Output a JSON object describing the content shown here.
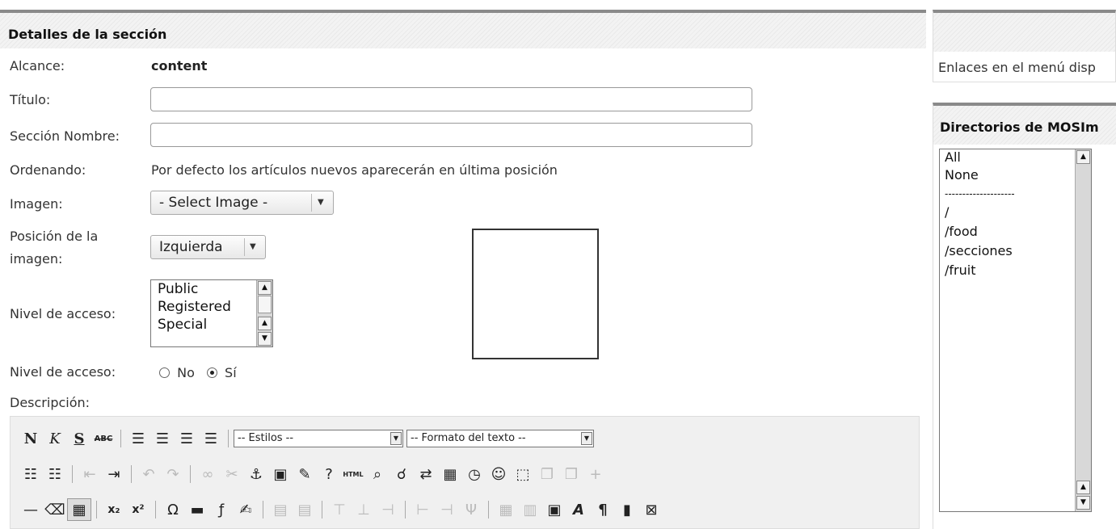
{
  "section_panel": {
    "title": "Detalles de la sección",
    "scope_label": "Alcance:",
    "scope_value": "content",
    "title_label": "Título:",
    "title_value": "",
    "section_name_label": "Sección Nombre:",
    "section_name_value": "",
    "ordering_label": "Ordenando:",
    "ordering_value": "Por defecto los artículos nuevos aparecerán en última posición",
    "image_label": "Imagen:",
    "image_select": "- Select Image -",
    "image_position_label_1": "Posición de la",
    "image_position_label_2": "imagen:",
    "image_position_select": "Izquierda",
    "access_label": "Nivel de acceso:",
    "access_options": [
      "Public",
      "Registered",
      "Special"
    ],
    "published_label": "Nivel de acceso:",
    "published_no": "No",
    "published_yes": "Sí",
    "published_selected": "Sí",
    "description_label": "Descripción:"
  },
  "editor_toolbar": {
    "styles_select": "-- Estilos --",
    "format_select": "-- Formato del texto --",
    "row1_buttons": [
      "N",
      "K",
      "S",
      "ABC"
    ],
    "row1_align_icons": [
      "align-left-icon",
      "align-center-icon",
      "align-right-icon",
      "align-justify-icon"
    ],
    "row2_icons": [
      "bullet-list-icon",
      "numbered-list-icon",
      "outdent-icon",
      "indent-icon",
      "undo-icon",
      "redo-icon",
      "link-icon",
      "unlink-icon",
      "anchor-icon",
      "image-icon",
      "cleanup-icon",
      "help-icon",
      "html-icon",
      "preview-icon",
      "find-icon",
      "replace-icon",
      "insert-date-icon",
      "insert-time-icon",
      "emoticon-icon",
      "fullscreen-icon",
      "copy-icon",
      "paste-icon",
      "add-icon"
    ],
    "row3_icons": [
      "horizontal-rule-icon",
      "eraser-icon",
      "table-icon",
      "subscript-icon",
      "superscript-icon",
      "omega-icon",
      "remove-format-icon",
      "flash-icon",
      "edit-icon",
      "table-props-icon",
      "cell-props-icon",
      "insert-row-before-icon",
      "insert-row-after-icon",
      "delete-row-icon",
      "insert-col-before-icon",
      "insert-col-after-icon",
      "delete-col-icon",
      "split-cell-icon",
      "merge-cell-icon",
      "layer-icon",
      "style-icon",
      "pilcrow-icon",
      "media-icon",
      "page-break-icon"
    ]
  },
  "right_panel": {
    "menu_links_text": "Enlaces en el menú disp",
    "mosimage_title": "Directorios de MOSIm",
    "mosimage_dirs": [
      "All",
      "None",
      "--------------------",
      "/",
      "/food",
      "/secciones",
      "/fruit"
    ]
  }
}
